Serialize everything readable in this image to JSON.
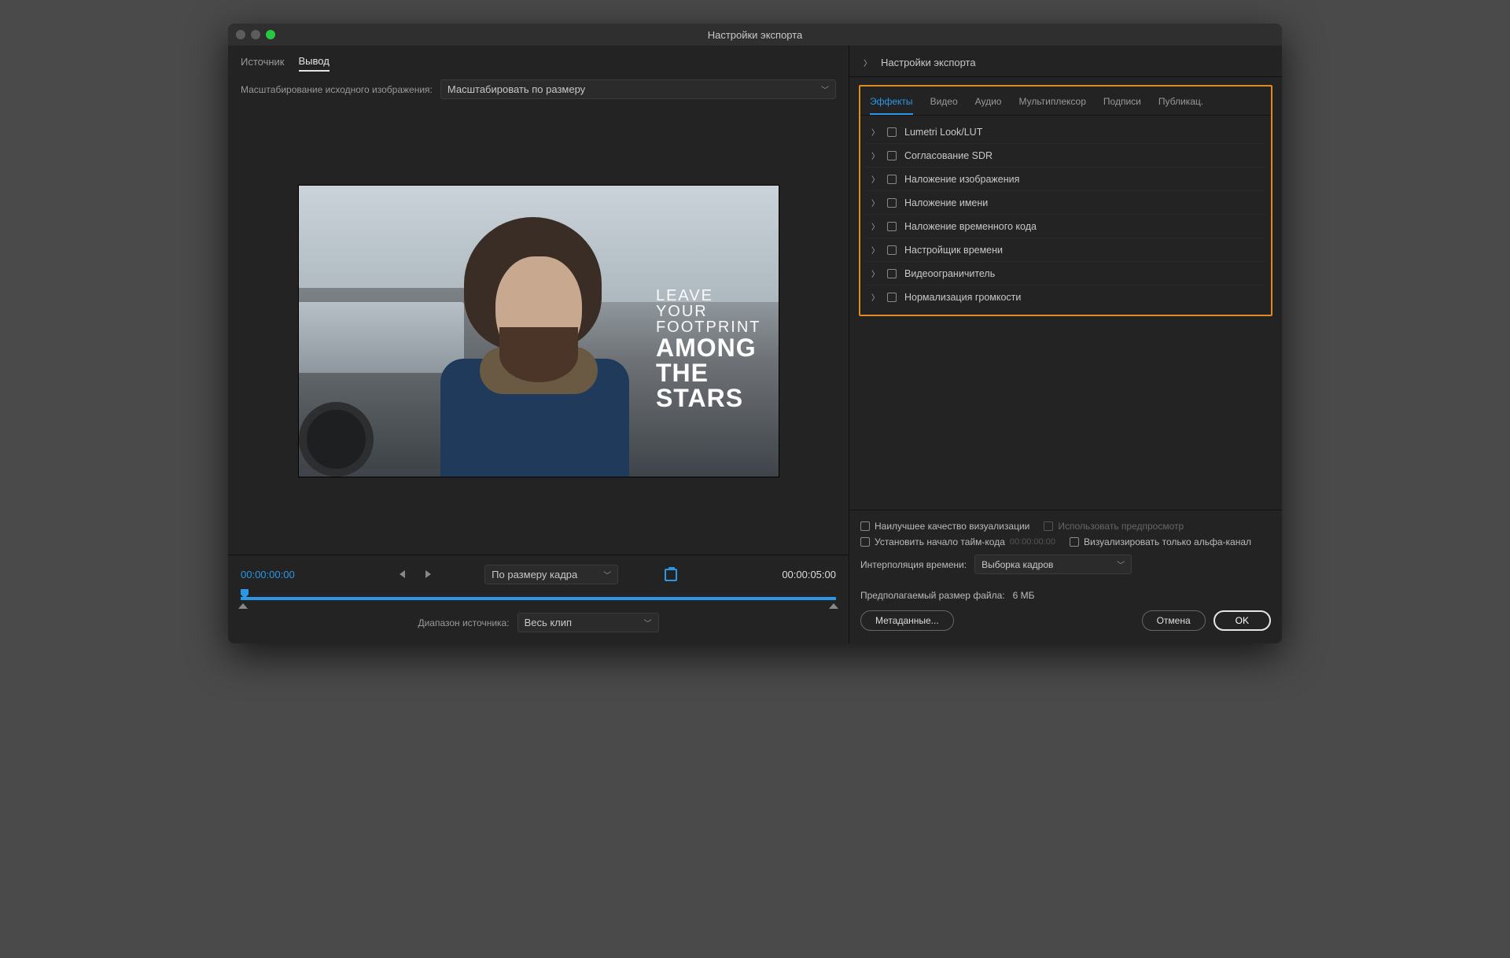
{
  "title": "Настройки экспорта",
  "src_tabs": {
    "source": "Источник",
    "output": "Вывод"
  },
  "scale": {
    "label": "Масштабирование исходного изображения:",
    "value": "Масштабировать по размеру"
  },
  "overlay": {
    "line1": "LEAVE",
    "line2": "YOUR",
    "line3": "FOOTPRINT",
    "line4": "AMONG",
    "line5": "THE",
    "line6": "STARS"
  },
  "timeline": {
    "in_tc": "00:00:00:00",
    "out_tc": "00:00:05:00",
    "fit_value": "По размеру кадра",
    "range_label": "Диапазон источника:",
    "range_value": "Весь клип"
  },
  "right": {
    "settings_title": "Настройки экспорта",
    "tabs": {
      "effects": "Эффекты",
      "video": "Видео",
      "audio": "Аудио",
      "mux": "Мультиплексор",
      "captions": "Подписи",
      "publish": "Публикац."
    },
    "effects": [
      "Lumetri Look/LUT",
      "Согласование SDR",
      "Наложение изображения",
      "Наложение имени",
      "Наложение временного кода",
      "Настройщик времени",
      "Видеоограничитель",
      "Нормализация громкости"
    ],
    "opts": {
      "max_quality": "Наилучшее качество визуализации",
      "use_preview": "Использовать предпросмотр",
      "set_start_tc": "Установить начало тайм-кода",
      "start_tc_value": "00:00:00:00",
      "alpha_only": "Визуализировать только альфа-канал",
      "interp_label": "Интерполяция времени:",
      "interp_value": "Выборка кадров"
    },
    "filesize_label": "Предполагаемый размер файла:",
    "filesize_value": "6 МБ",
    "metadata": "Метаданные...",
    "cancel": "Отмена",
    "ok": "OK"
  }
}
